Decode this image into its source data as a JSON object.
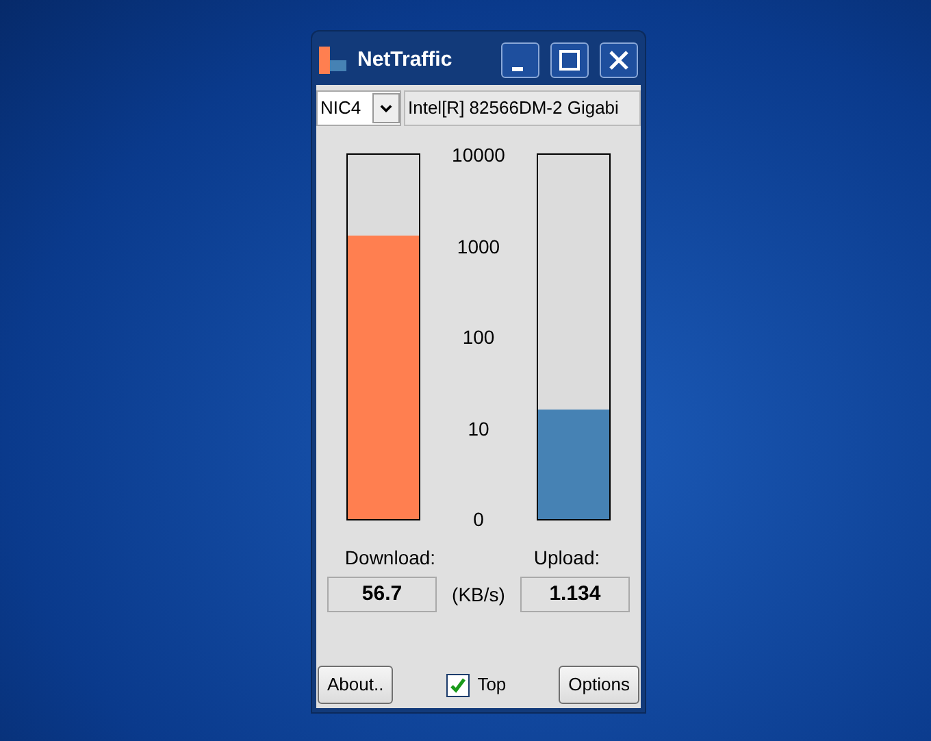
{
  "window": {
    "title": "NetTraffic"
  },
  "adapter": {
    "nic": "NIC4",
    "name": "Intel[R] 82566DM-2 Gigabi"
  },
  "meters": [
    {
      "label": "Download:",
      "level": 0.78,
      "value": "56.7",
      "color": "#ff7f50"
    },
    {
      "label": "Upload:",
      "level": 0.3,
      "value": "1.134",
      "color": "#4682b4"
    }
  ],
  "scale_labels": [
    "10000",
    "1000",
    "100",
    "10",
    "0"
  ],
  "unit": "(KB/s)",
  "buttons": {
    "about": "About..",
    "options": "Options"
  },
  "top_checkbox": {
    "label": "Top",
    "checked": true
  }
}
